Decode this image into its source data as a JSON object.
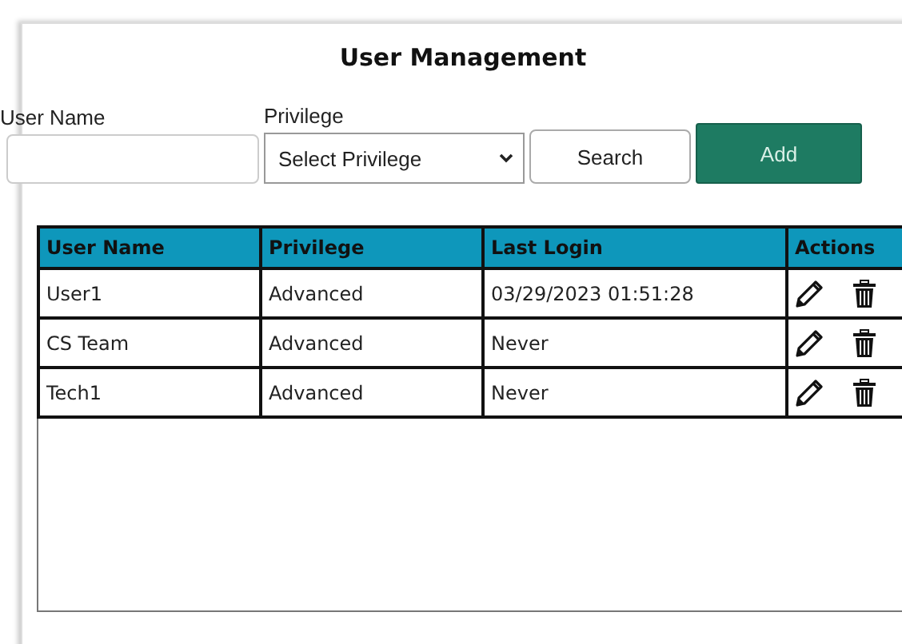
{
  "title": "User Management",
  "filters": {
    "user_name_label": "User Name",
    "privilege_label": "Privilege",
    "privilege_value": "Select Privilege"
  },
  "buttons": {
    "search": "Search",
    "add": "Add"
  },
  "table": {
    "columns": [
      "User Name",
      "Privilege",
      "Last Login",
      "Actions"
    ],
    "rows": [
      {
        "user_name": "User1",
        "privilege": "Advanced",
        "last_login": "03/29/2023 01:51:28"
      },
      {
        "user_name": "CS Team",
        "privilege": "Advanced",
        "last_login": "Never"
      },
      {
        "user_name": "Tech1",
        "privilege": "Advanced",
        "last_login": "Never"
      }
    ]
  }
}
